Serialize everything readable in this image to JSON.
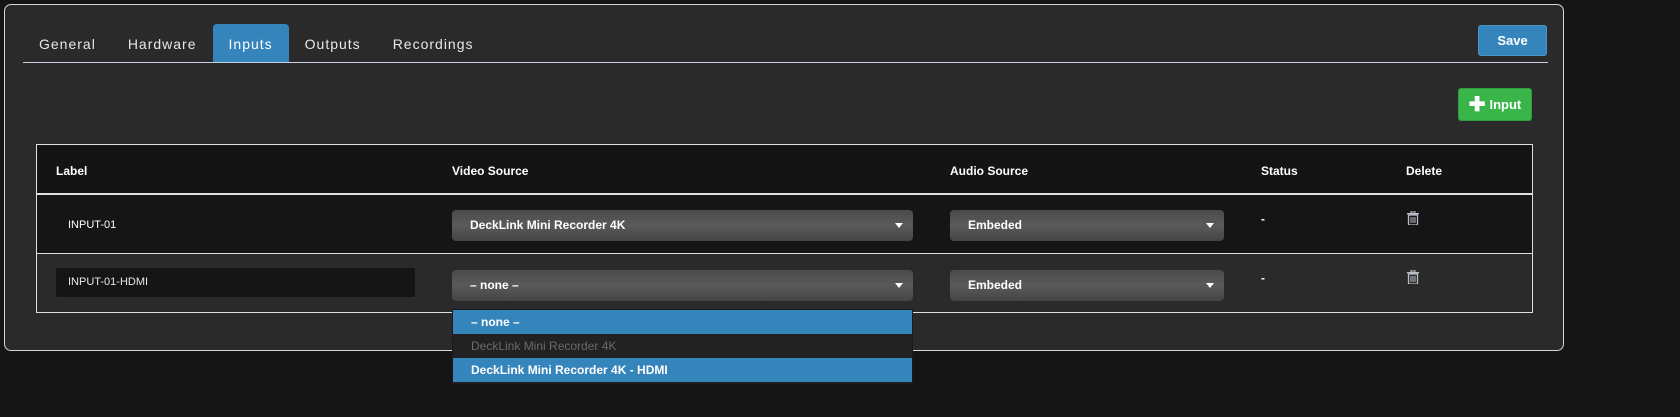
{
  "tabs": [
    {
      "label": "General"
    },
    {
      "label": "Hardware"
    },
    {
      "label": "Inputs"
    },
    {
      "label": "Outputs"
    },
    {
      "label": "Recordings"
    }
  ],
  "save_label": "Save",
  "add_input_label": "Input",
  "table": {
    "headers": {
      "label": "Label",
      "video": "Video Source",
      "audio": "Audio Source",
      "status": "Status",
      "delete": "Delete"
    },
    "rows": [
      {
        "label": "INPUT-01",
        "video": "DeckLink Mini Recorder 4K",
        "audio": "Embeded",
        "status": "-"
      },
      {
        "label": "INPUT-01-HDMI",
        "video": "– none –",
        "audio": "Embeded",
        "status": "-"
      }
    ]
  },
  "dropdown_options": [
    {
      "label": "– none –"
    },
    {
      "label": "DeckLink Mini Recorder 4K"
    },
    {
      "label": "DeckLink Mini Recorder 4K - HDMI"
    }
  ],
  "colors": {
    "accent": "#3585bc",
    "add": "#3ab54a",
    "panel": "#2a2a2a"
  }
}
